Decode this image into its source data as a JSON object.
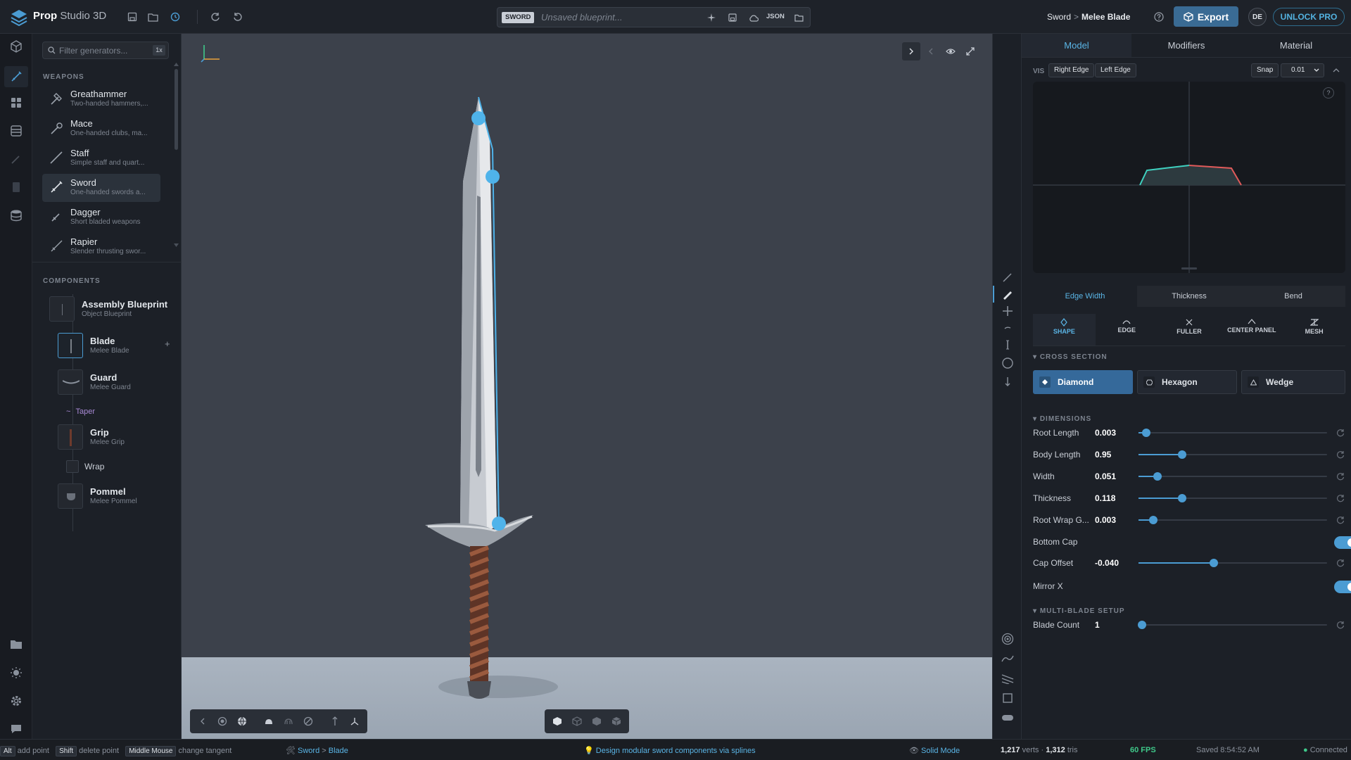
{
  "app": {
    "brand_bold": "Prop",
    "brand_rest": "Studio 3D"
  },
  "blueprint": {
    "tag": "SWORD",
    "name": "Unsaved blueprint...",
    "json_label": "JSON"
  },
  "breadcrumb": {
    "item1": "Sword",
    "sep": ">",
    "item2": "Melee Blade"
  },
  "header": {
    "export_label": "Export",
    "avatar": "DE",
    "unlock_label": "UNLOCK PRO"
  },
  "sidebar": {
    "filter_placeholder": "Filter generators...",
    "filter_key": "1x",
    "weapons_heading": "WEAPONS",
    "generators": [
      {
        "name": "Greathammer",
        "desc": "Two-handed hammers,..."
      },
      {
        "name": "Mace",
        "desc": "One-handed clubs, ma..."
      },
      {
        "name": "Staff",
        "desc": "Simple staff and quart..."
      },
      {
        "name": "Sword",
        "desc": "One-handed swords a..."
      },
      {
        "name": "Dagger",
        "desc": "Short bladed weapons"
      },
      {
        "name": "Rapier",
        "desc": "Slender thrusting swor..."
      }
    ],
    "components_heading": "COMPONENTS",
    "components": [
      {
        "name": "Assembly Blueprint",
        "desc": "Object Blueprint"
      },
      {
        "name": "Blade",
        "desc": "Melee Blade"
      },
      {
        "name": "Guard",
        "desc": "Melee Guard"
      },
      {
        "name": "Taper",
        "desc": ""
      },
      {
        "name": "Grip",
        "desc": "Melee Grip"
      },
      {
        "name": "Wrap",
        "desc": ""
      },
      {
        "name": "Pommel",
        "desc": "Melee Pommel"
      }
    ],
    "add_symbol": "+"
  },
  "panel": {
    "tabs": [
      "Model",
      "Modifiers",
      "Material"
    ],
    "vis_label": "VIS",
    "right_edge": "Right Edge",
    "left_edge": "Left Edge",
    "snap_label": "Snap",
    "snap_value": "0.01",
    "help": "?",
    "subtabs": [
      "Edge Width",
      "Thickness",
      "Bend"
    ],
    "modes": [
      "SHAPE",
      "EDGE",
      "FULLER",
      "CENTER PANEL",
      "MESH"
    ],
    "cross_section_heading": "CROSS SECTION",
    "cross_sections": [
      "Diamond",
      "Hexagon",
      "Wedge"
    ],
    "dimensions_heading": "DIMENSIONS",
    "dimensions": [
      {
        "label": "Root Length",
        "value": "0.003",
        "pct": 4
      },
      {
        "label": "Body Length",
        "value": "0.95",
        "pct": 23
      },
      {
        "label": "Width",
        "value": "0.051",
        "pct": 10
      },
      {
        "label": "Thickness",
        "value": "0.118",
        "pct": 23
      },
      {
        "label": "Root Wrap G...",
        "value": "0.003",
        "pct": 8
      }
    ],
    "bottom_cap_label": "Bottom Cap",
    "bottom_cap_on": true,
    "cap_offset": {
      "label": "Cap Offset",
      "value": "-0.040",
      "pct": 40
    },
    "mirror_x_label": "Mirror X",
    "mirror_x_on": true,
    "multi_heading": "MULTI-BLADE SETUP",
    "blade_count": {
      "label": "Blade Count",
      "value": "1",
      "pct": 2
    }
  },
  "status": {
    "k1": "Alt",
    "t1": "add point",
    "k2": "Shift",
    "t2": "delete point",
    "k3": "Middle Mouse",
    "t3": "change tangent",
    "crumb1": "Sword",
    "crumb_sep": ">",
    "crumb2": "Blade",
    "tip": "Design modular sword components via splines",
    "mode": "Solid Mode",
    "verts_num": "1,217",
    "verts_label": "verts",
    "dot": "·",
    "tris_num": "1,312",
    "tris_label": "tris",
    "fps": "60 FPS",
    "saved": "Saved 8:54:52 AM",
    "connected": "Connected"
  },
  "colors": {
    "accent": "#4b9cd3",
    "export": "#3a6b94",
    "selected_cross": "#35699a",
    "fps_green": "#3fc98a"
  }
}
